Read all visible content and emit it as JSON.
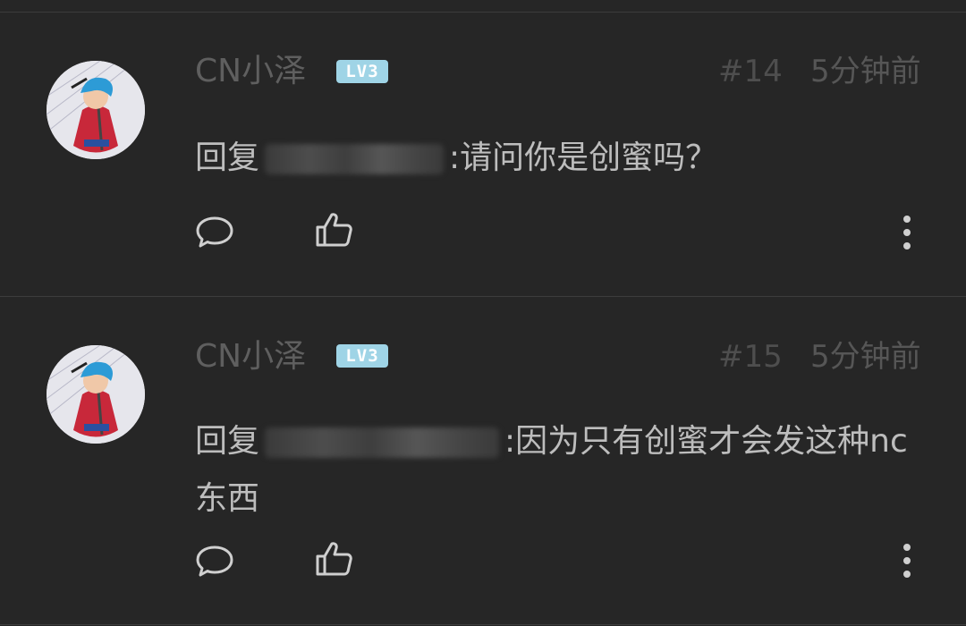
{
  "comments": [
    {
      "username": "CN小泽",
      "badge": "LV3",
      "floor": "#14",
      "time": "5分钟前",
      "reply_prefix": "回复",
      "reply_text": ":请问你是创蜜吗？",
      "actions": [
        "comment-icon",
        "like-icon",
        "more-icon"
      ]
    },
    {
      "username": "CN小泽",
      "badge": "LV3",
      "floor": "#15",
      "time": "5分钟前",
      "reply_prefix": "回复",
      "reply_text": ":因为只有创蜜才会发这种nc东西",
      "actions": [
        "comment-icon",
        "like-icon",
        "more-icon"
      ]
    }
  ],
  "colors": {
    "background": "#262626",
    "username": "#5f5f5f",
    "body_text": "#bdbdbd",
    "badge": "#9fd4e6",
    "icon": "#cfcfcf"
  }
}
